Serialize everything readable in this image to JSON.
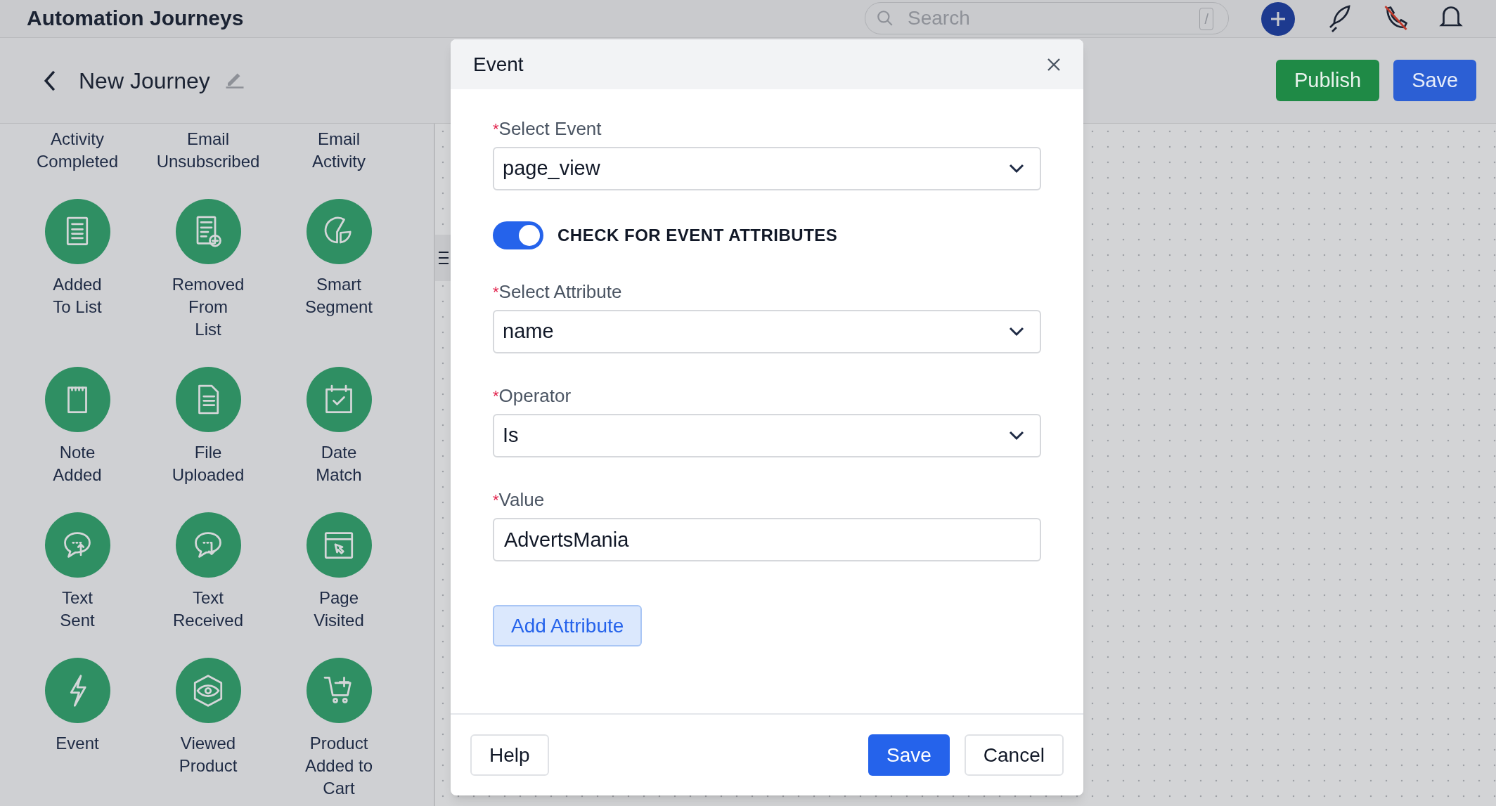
{
  "app": {
    "title": "Automation Journeys",
    "search": {
      "placeholder": "Search",
      "shortcut": "/"
    }
  },
  "journey": {
    "title": "New Journey",
    "buttons": [
      {
        "label": "Publish",
        "kind": "publish"
      },
      {
        "label": "Save",
        "kind": "save"
      }
    ]
  },
  "palette": {
    "items": [
      {
        "label": "Activity\nCompleted"
      },
      {
        "label": "Email\nUnsubscribed"
      },
      {
        "label": "Email\nActivity"
      },
      {
        "label": "Added\nTo List"
      },
      {
        "label": "Removed\nFrom\nList"
      },
      {
        "label": "Smart\nSegment"
      },
      {
        "label": "Note\nAdded"
      },
      {
        "label": "File\nUploaded"
      },
      {
        "label": "Date\nMatch"
      },
      {
        "label": "Text\nSent"
      },
      {
        "label": "Text\nReceived"
      },
      {
        "label": "Page\nVisited"
      },
      {
        "label": "Event"
      },
      {
        "label": "Viewed\nProduct"
      },
      {
        "label": "Product\nAdded to\nCart"
      }
    ]
  },
  "modal": {
    "title": "Event",
    "fields": [
      {
        "kind": "select",
        "mark": "*",
        "label": "Select Event",
        "value": "page_view"
      },
      {
        "kind": "toggle",
        "label": "CHECK FOR EVENT ATTRIBUTES",
        "on": true
      },
      {
        "kind": "select",
        "mark": "*",
        "label": "Select Attribute",
        "value": "name"
      },
      {
        "kind": "select",
        "mark": "*",
        "label": "Operator",
        "value": "Is"
      },
      {
        "kind": "input",
        "mark": "*",
        "label": "Value",
        "value": "AdvertsMania"
      }
    ],
    "add_button": "Add Attribute",
    "footer": {
      "help": "Help",
      "save": "Save",
      "cancel": "Cancel"
    }
  }
}
